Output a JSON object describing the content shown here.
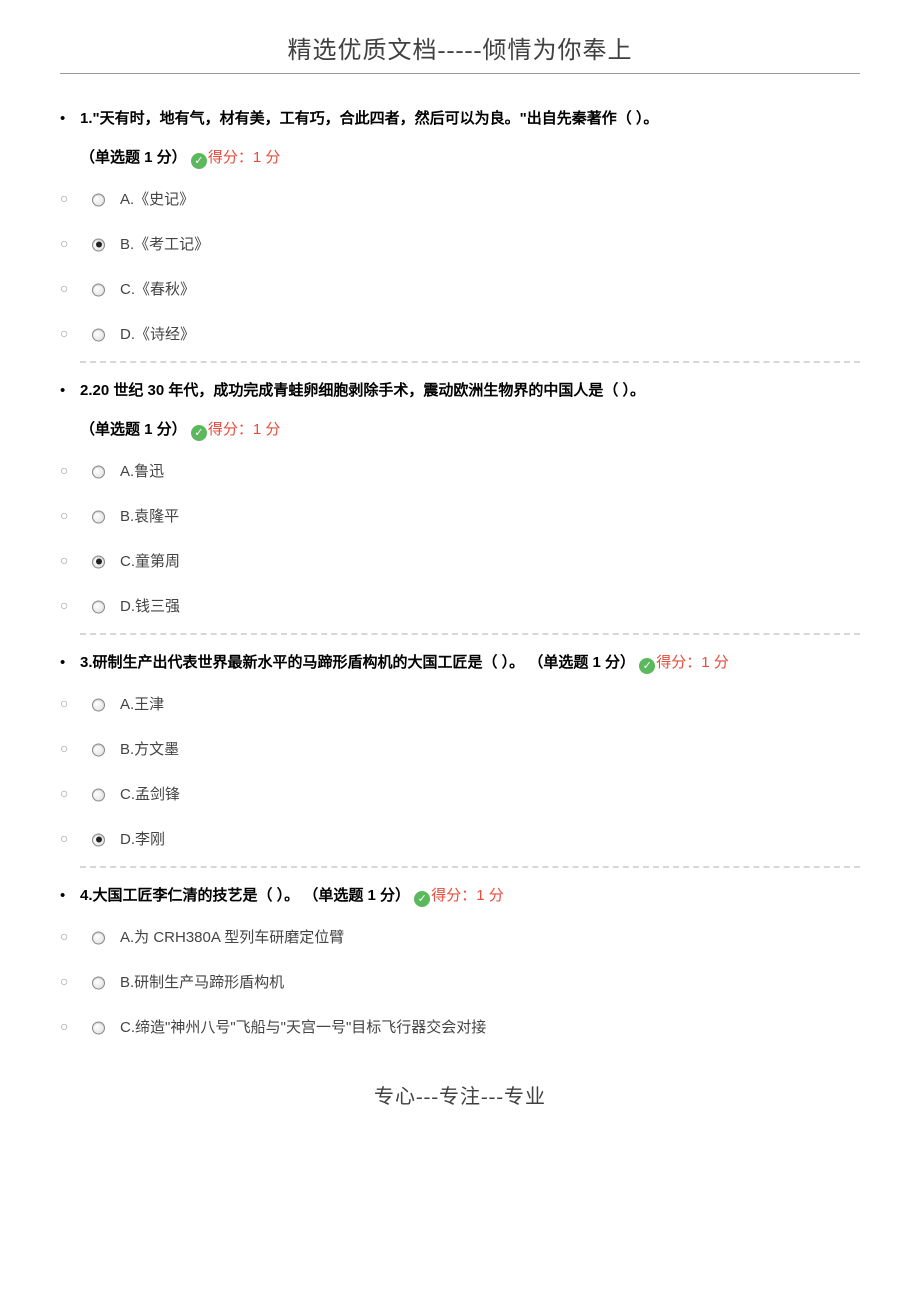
{
  "header": "精选优质文档-----倾情为你奉上",
  "footer": "专心---专注---专业",
  "score_label": "得分：1 分",
  "questions": [
    {
      "num": "1.",
      "text": "\"天有时，地有气，材有美，工有巧，合此四者，然后可以为良。\"出自先秦著作（ ）。",
      "meta": "（单选题 1 分）",
      "selected": 1,
      "options": [
        "A.《史记》",
        "B.《考工记》",
        "C.《春秋》",
        "D.《诗经》"
      ]
    },
    {
      "num": "2.",
      "text": "20 世纪 30 年代，成功完成青蛙卵细胞剥除手术，震动欧洲生物界的中国人是（ ）。",
      "meta": "（单选题 1 分）",
      "selected": 2,
      "options": [
        "A.鲁迅",
        "B.袁隆平",
        "C.童第周",
        "D.钱三强"
      ]
    },
    {
      "num": "3.",
      "text": "研制生产出代表世界最新水平的马蹄形盾构机的大国工匠是（ ）。",
      "meta": "（单选题 1 分）",
      "selected": 3,
      "options": [
        "A.王津",
        "B.方文墨",
        "C.孟剑锋",
        "D.李刚"
      ]
    },
    {
      "num": "4.",
      "text": "大国工匠李仁清的技艺是（ ）。",
      "meta": "（单选题 1 分）",
      "selected": -1,
      "options": [
        "A.为 CRH380A 型列车研磨定位臂",
        "B.研制生产马蹄形盾构机",
        "C.缔造\"神州八号\"飞船与\"天宫一号\"目标飞行器交会对接"
      ]
    }
  ]
}
